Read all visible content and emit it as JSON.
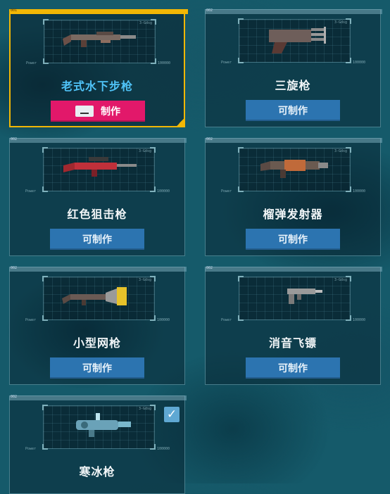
{
  "labels": {
    "id": "002",
    "id_first": "001",
    "rate": "3-Gdsg",
    "power": "Power",
    "ammo": "100000"
  },
  "weapons": [
    {
      "name": "老式水下步枪",
      "button": "制作",
      "state": "craft"
    },
    {
      "name": "三旋枪",
      "button": "可制作",
      "state": "available"
    },
    {
      "name": "红色狙击枪",
      "button": "可制作",
      "state": "available"
    },
    {
      "name": "榴弹发射器",
      "button": "可制作",
      "state": "available"
    },
    {
      "name": "小型网枪",
      "button": "可制作",
      "state": "available"
    },
    {
      "name": "消音飞镖",
      "button": "可制作",
      "state": "available"
    },
    {
      "name": "寒冰枪",
      "button": "",
      "state": "owned"
    }
  ],
  "colors": {
    "selected_border": "#f2b705",
    "craft_button": "#e2186a",
    "available_button": "#2c74b0",
    "selected_name": "#4fc3f7"
  }
}
